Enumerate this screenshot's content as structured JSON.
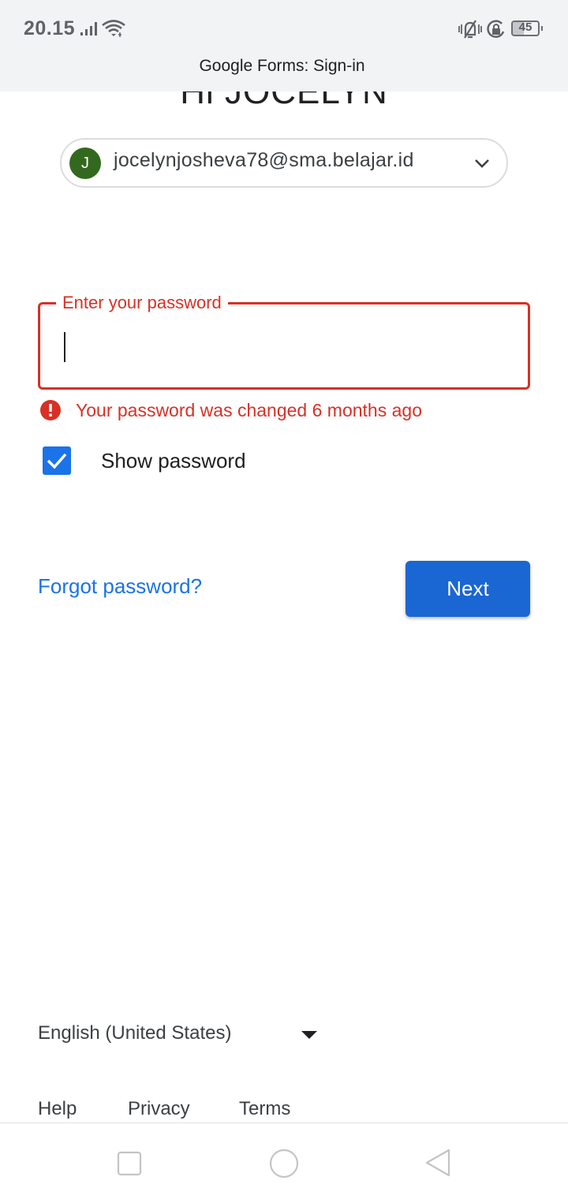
{
  "status_bar": {
    "time": "20.15",
    "battery_level": "45",
    "battery_fraction": 0.45,
    "icons": [
      "signal-icon",
      "wifi-icon",
      "vibrate-icon",
      "rotation-lock-icon",
      "battery-icon"
    ]
  },
  "browser": {
    "title": "Google Forms: Sign-in"
  },
  "page": {
    "greeting": "Hi JOCELYN",
    "account": {
      "avatar_initial": "J",
      "avatar_color": "#33691e",
      "email": "jocelynjosheva78@sma.belajar.id"
    },
    "password_field": {
      "label": "Enter your password",
      "value": ""
    },
    "error_message": "Your password was changed 6 months ago",
    "show_password": {
      "label": "Show password",
      "checked": true
    },
    "forgot_password_label": "Forgot password?",
    "next_label": "Next"
  },
  "footer": {
    "language": "English (United States)",
    "links": [
      "Help",
      "Privacy",
      "Terms"
    ]
  },
  "colors": {
    "accent": "#1a73e8",
    "error": "#d93025",
    "button": "#1a66d2"
  }
}
